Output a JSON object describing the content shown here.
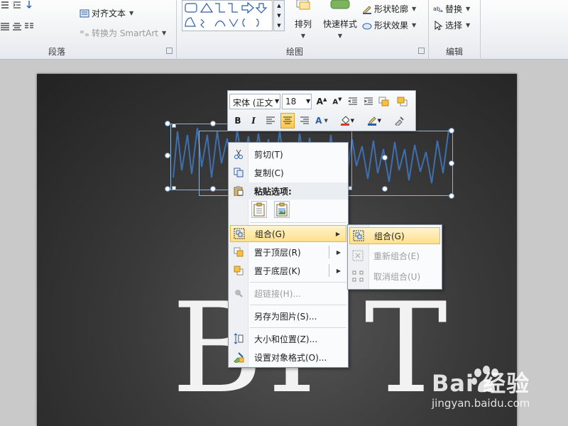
{
  "ribbon": {
    "groups": {
      "paragraph": "段落",
      "drawing": "绘图",
      "editing": "编辑"
    },
    "paragraph": {
      "align_text": "对齐文本",
      "convert_smartart": "转换为 SmartArt"
    },
    "drawing": {
      "arrange": "排列",
      "quick_styles": "快速样式",
      "shape_outline": "形状轮廓",
      "shape_effects": "形状效果"
    },
    "editing": {
      "replace": "替换",
      "select": "选择"
    }
  },
  "mini_toolbar": {
    "font_name": "宋体 (正文",
    "font_size": "18"
  },
  "context_menu": {
    "items": {
      "cut": "剪切(T)",
      "copy": "复制(C)",
      "paste_options": "粘贴选项:",
      "group": "组合(G)",
      "bring_to_front": "置于顶层(R)",
      "send_to_back": "置于底层(K)",
      "hyperlink": "超链接(H)...",
      "save_as_picture": "另存为图片(S)...",
      "size_position": "大小和位置(Z)...",
      "format_object": "设置对象格式(O)..."
    }
  },
  "submenu": {
    "group": "组合(G)",
    "regroup": "重新组合(E)",
    "ungroup": "取消组合(U)"
  },
  "slide": {
    "big_text": "BI    T"
  },
  "watermark": {
    "logo": "Bai  经验",
    "url": "jingyan.baidu.com"
  },
  "colors": {
    "accent_hover": "#ffe08b",
    "selection": "#6a8fb5",
    "scribble": "#3e6fae"
  }
}
